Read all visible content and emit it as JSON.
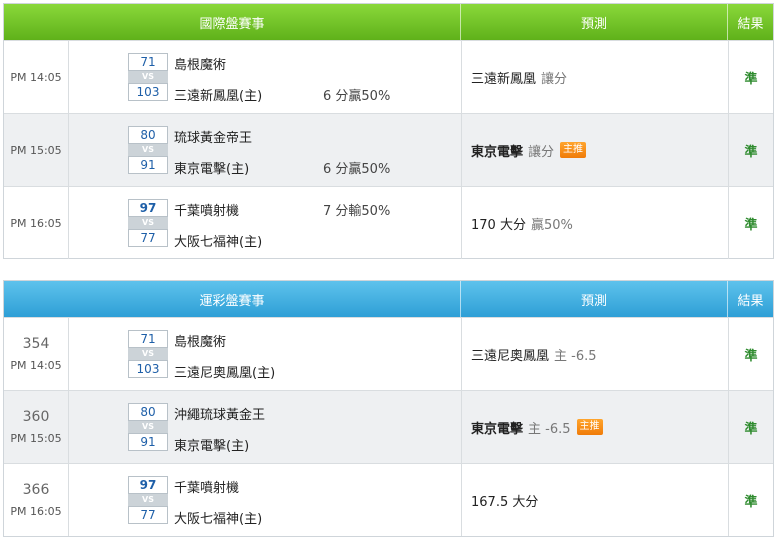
{
  "panel1": {
    "headers": {
      "match": "國際盤賽事",
      "prediction": "預測",
      "result": "結果"
    },
    "rows": [
      {
        "time": "PM 14:05",
        "score_top": "71",
        "score_bottom": "103",
        "team_top": "島根魔術",
        "team_bottom": "三遠新鳳凰(主)",
        "odds": "6 分贏50%",
        "odds_row": "bottom",
        "pick": "三遠新鳳凰",
        "pick_bold": false,
        "extra": "讓分",
        "badge": "",
        "result": "準"
      },
      {
        "time": "PM 15:05",
        "score_top": "80",
        "score_bottom": "91",
        "team_top": "琉球黃金帝王",
        "team_bottom": "東京電擊(主)",
        "odds": "6 分贏50%",
        "odds_row": "bottom",
        "pick": "東京電擊",
        "pick_bold": true,
        "extra": "讓分",
        "badge": "主推",
        "result": "準"
      },
      {
        "time": "PM 16:05",
        "score_top": "97",
        "score_bottom": "77",
        "team_top": "千葉噴射機",
        "team_bottom": "大阪七福神(主)",
        "odds": "7 分輸50%",
        "odds_row": "top",
        "pick": "170 大分",
        "pick_bold": false,
        "extra": "贏50%",
        "badge": "",
        "result": "準"
      }
    ]
  },
  "panel2": {
    "headers": {
      "match": "運彩盤賽事",
      "prediction": "預測",
      "result": "結果"
    },
    "rows": [
      {
        "code": "354",
        "time": "PM 14:05",
        "score_top": "71",
        "score_bottom": "103",
        "team_top": "島根魔術",
        "team_bottom": "三遠尼奧鳳凰(主)",
        "pick": "三遠尼奧鳳凰",
        "pick_bold": false,
        "extra": "主 -6.5",
        "badge": "",
        "result": "準"
      },
      {
        "code": "360",
        "time": "PM 15:05",
        "score_top": "80",
        "score_bottom": "91",
        "team_top": "沖繩琉球黃金王",
        "team_bottom": "東京電擊(主)",
        "pick": "東京電擊",
        "pick_bold": true,
        "extra": "主 -6.5",
        "badge": "主推",
        "result": "準"
      },
      {
        "code": "366",
        "time": "PM 16:05",
        "score_top": "97",
        "score_bottom": "77",
        "team_top": "千葉噴射機",
        "team_bottom": "大阪七福神(主)",
        "pick": "167.5 大分",
        "pick_bold": false,
        "extra": "",
        "badge": "",
        "result": "準"
      }
    ]
  },
  "vs_label": "VS"
}
